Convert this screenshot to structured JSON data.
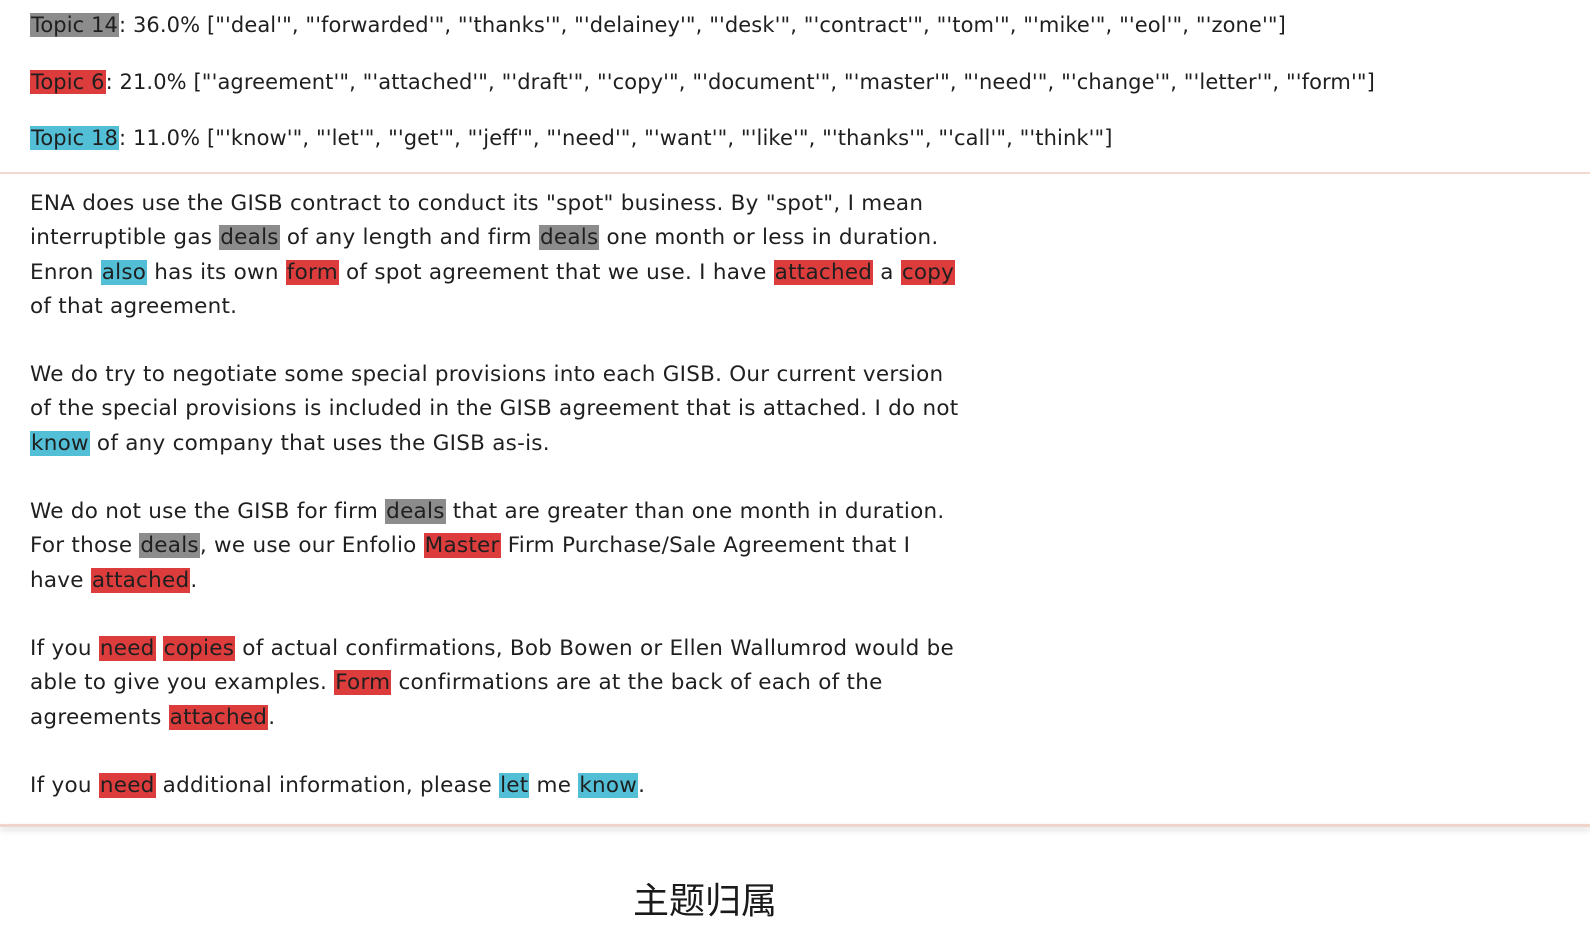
{
  "topics": [
    {
      "label": "Topic 14",
      "share": ": 36.0% ",
      "words": "[\"'deal'\", \"'forwarded'\", \"'thanks'\", \"'delainey'\", \"'desk'\", \"'contract'\", \"'tom'\", \"'mike'\", \"'eol'\", \"'zone'\"]",
      "color": "#8c8c8c"
    },
    {
      "label": "Topic 6",
      "share": ": 21.0% ",
      "words": "[\"'agreement'\", \"'attached'\", \"'draft'\", \"'copy'\", \"'document'\", \"'master'\", \"'need'\", \"'change'\", \"'letter'\", \"'form'\"]",
      "color": "#dc3c3c"
    },
    {
      "label": "Topic 18",
      "share": ": 11.0% ",
      "words": "[\"'know'\", \"'let'\", \"'get'\", \"'jeff'\", \"'need'\", \"'want'\", \"'like'\", \"'thanks'\", \"'call'\", \"'think'\"]",
      "color": "#52bfd6"
    }
  ],
  "document": {
    "paragraphs": [
      [
        {
          "t": "ENA does use the GISB contract to conduct its \"spot\" business. By \"spot\", I mean interruptible gas "
        },
        {
          "t": "deals",
          "h": "gray"
        },
        {
          "t": " of any length and firm "
        },
        {
          "t": "deals",
          "h": "gray"
        },
        {
          "t": " one month or less in duration. Enron "
        },
        {
          "t": "also",
          "h": "blue"
        },
        {
          "t": " has its own "
        },
        {
          "t": "form",
          "h": "red"
        },
        {
          "t": " of spot agreement that we use. I have "
        },
        {
          "t": "attached",
          "h": "red"
        },
        {
          "t": " a "
        },
        {
          "t": "copy",
          "h": "red"
        },
        {
          "t": " of that agreement."
        }
      ],
      [
        {
          "t": "We do try to negotiate some special provisions into each GISB. Our current version of the special provisions is included in the GISB agreement that is attached. I do not "
        },
        {
          "t": "know",
          "h": "blue"
        },
        {
          "t": " of any company that uses the GISB as-is."
        }
      ],
      [
        {
          "t": "We do not use the GISB for firm "
        },
        {
          "t": "deals",
          "h": "gray"
        },
        {
          "t": " that are greater than one month in duration. For those "
        },
        {
          "t": "deals",
          "h": "gray"
        },
        {
          "t": ", we use our Enfolio "
        },
        {
          "t": "Master",
          "h": "red"
        },
        {
          "t": " Firm Purchase/Sale Agreement that I have "
        },
        {
          "t": "attached",
          "h": "red"
        },
        {
          "t": "."
        }
      ],
      [
        {
          "t": "If you "
        },
        {
          "t": "need",
          "h": "red"
        },
        {
          "t": " "
        },
        {
          "t": "copies",
          "h": "red"
        },
        {
          "t": " of actual confirmations, Bob Bowen or Ellen Wallumrod would be able to give you examples. "
        },
        {
          "t": "Form",
          "h": "red"
        },
        {
          "t": " confirmations are at the back of each of the agreements "
        },
        {
          "t": "attached",
          "h": "red"
        },
        {
          "t": "."
        }
      ],
      [
        {
          "t": "If you "
        },
        {
          "t": "need",
          "h": "red"
        },
        {
          "t": " additional information, please "
        },
        {
          "t": "let",
          "h": "blue"
        },
        {
          "t": " me "
        },
        {
          "t": "know",
          "h": "blue"
        },
        {
          "t": "."
        }
      ]
    ]
  },
  "caption": "主题归属"
}
